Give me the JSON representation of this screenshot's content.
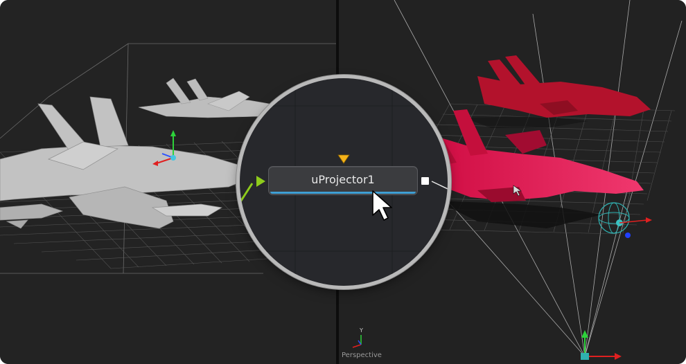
{
  "left_viewport": {
    "description": "3D viewport with grey aircraft models"
  },
  "right_viewport": {
    "label": "Perspective",
    "axis_label": "Y"
  },
  "node": {
    "title": "uProjector1",
    "accent_color": "#3f9fd4",
    "input_color": "#8ecb1c",
    "mask_input_color": "#f4b21a",
    "output_color": "#ffffff"
  },
  "icons": {
    "cursor": "mouse-pointer-icon",
    "input_port": "triangle-right-icon",
    "mask_port": "triangle-down-icon",
    "output_port": "square-icon"
  },
  "colors": {
    "projected_color": "#e0115f",
    "grid": "#6a6a6a",
    "frame_bg": "#1b1b1c"
  }
}
